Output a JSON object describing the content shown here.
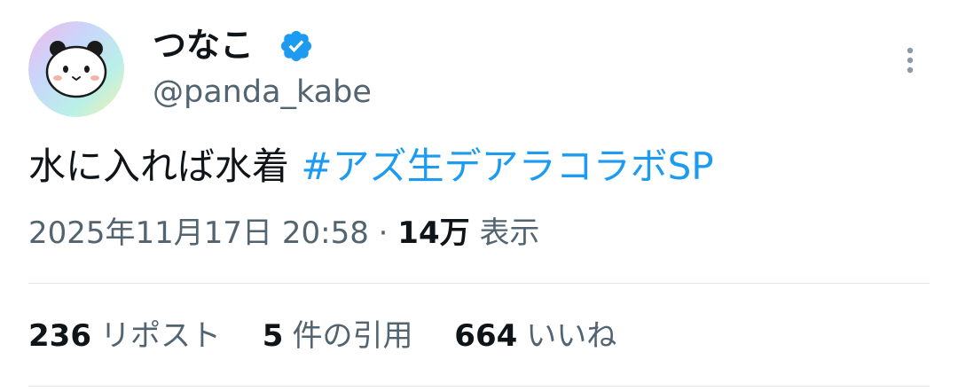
{
  "author": {
    "display_name": "つなこ",
    "handle": "@panda_kabe",
    "verified": true,
    "verified_icon": "verified-badge-icon",
    "avatar_icon": "panda-avatar",
    "colors": {
      "verified": "#1d9bf0"
    }
  },
  "tweet": {
    "text": "水に入れば水着",
    "hashtag": "#アズ生デアラコラボSP",
    "hashtag_color": "#1d9bf0"
  },
  "meta": {
    "datetime": "2025年11月17日 20:58",
    "separator": "·",
    "views_count": "14万",
    "views_label": "表示"
  },
  "stats": {
    "reposts": {
      "count": "236",
      "label": "リポスト"
    },
    "quotes": {
      "count": "5",
      "label": "件の引用"
    },
    "likes": {
      "count": "664",
      "label": "いいね"
    }
  },
  "more_icon": "more-vertical-icon"
}
